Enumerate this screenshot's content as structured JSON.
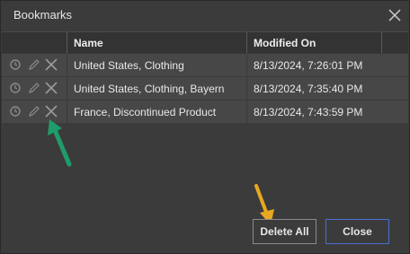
{
  "dialog": {
    "title": "Bookmarks",
    "close_icon": "close-icon"
  },
  "table": {
    "columns": [
      "Name",
      "Modified On"
    ],
    "rows": [
      {
        "name": "United States, Clothing",
        "modified": "8/13/2024, 7:26:01 PM"
      },
      {
        "name": "United States, Clothing, Bayern",
        "modified": "8/13/2024, 7:35:40 PM"
      },
      {
        "name": "France, Discontinued Product",
        "modified": "8/13/2024, 7:43:59 PM"
      }
    ],
    "row_icons": [
      "apply-icon",
      "edit-icon",
      "delete-icon"
    ]
  },
  "buttons": {
    "delete_all": "Delete All",
    "close": "Close"
  },
  "annotations": {
    "green_arrow": "#1f9c6b",
    "orange_arrow": "#e8a722"
  },
  "colors": {
    "background": "#3b3b3b",
    "row": "#474747",
    "header": "#333333",
    "close_border": "#4a6fd0"
  }
}
